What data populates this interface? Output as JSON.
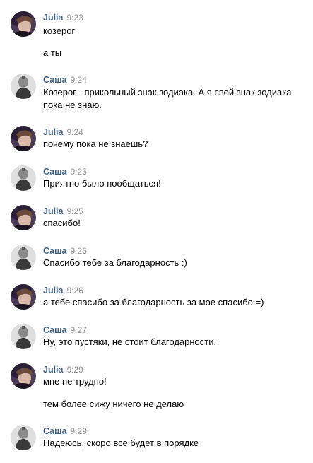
{
  "messages": [
    {
      "author": "Julia",
      "time": "9:23",
      "avatar": "julia-avatar",
      "lines": [
        "козерог",
        "а ты"
      ]
    },
    {
      "author": "Саша",
      "time": "9:24",
      "avatar": "sasha-avatar",
      "lines": [
        "Козерог - прикольный знак зодиака. А я свой знак зодиака пока не знаю."
      ]
    },
    {
      "author": "Julia",
      "time": "9:24",
      "avatar": "julia-avatar",
      "lines": [
        "почему пока не знаешь?"
      ]
    },
    {
      "author": "Саша",
      "time": "9:25",
      "avatar": "sasha-avatar",
      "lines": [
        "Приятно было пообщаться!"
      ]
    },
    {
      "author": "Julia",
      "time": "9:25",
      "avatar": "julia-avatar",
      "lines": [
        "спасибо!"
      ]
    },
    {
      "author": "Саша",
      "time": "9:26",
      "avatar": "sasha-avatar",
      "lines": [
        "Спасибо тебе за благодарность :)"
      ]
    },
    {
      "author": "Julia",
      "time": "9:26",
      "avatar": "julia-avatar",
      "lines": [
        "а тебе спасибо за благодарность за мое спасибо =)"
      ]
    },
    {
      "author": "Саша",
      "time": "9:27",
      "avatar": "sasha-avatar",
      "lines": [
        "Ну, это пустяки, не стоит благодарности."
      ]
    },
    {
      "author": "Julia",
      "time": "9:29",
      "avatar": "julia-avatar",
      "lines": [
        "мне не трудно!",
        "тем более сижу ничего не делаю"
      ]
    },
    {
      "author": "Саша",
      "time": "9:29",
      "avatar": "sasha-avatar",
      "lines": [
        "Надеюсь, скоро все будет в порядке"
      ]
    }
  ]
}
